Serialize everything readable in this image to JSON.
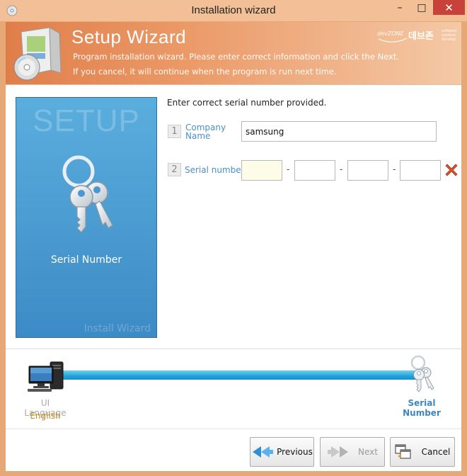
{
  "window": {
    "title": "Installation wizard",
    "min_glyph": "–",
    "max_glyph": "□",
    "close_glyph": "✕"
  },
  "header": {
    "title": "Setup Wizard",
    "line1": "Program installation wizard. Please enter correct information and click the Next.",
    "line2": "If you cancel, it will continue when the program is run next time.",
    "brand_small": "devZONE",
    "brand_big": "데브존",
    "brand_tag": "software solution develop"
  },
  "left_panel": {
    "heading": "SETUP",
    "label": "Serial Number",
    "watermark": "Install Wizard"
  },
  "form": {
    "instruction": "Enter correct serial number provided.",
    "company": {
      "number": "1",
      "label_line1": "Company",
      "label_line2": "Name",
      "value": "samsung"
    },
    "serial": {
      "number": "2",
      "label": "Serial number",
      "separator": "-",
      "parts": [
        "",
        "",
        "",
        ""
      ]
    }
  },
  "progress": {
    "step1_label": "UI Language",
    "step1_value": "English",
    "step2_label": "Serial Number",
    "fraction": 1.0
  },
  "buttons": {
    "previous": "Previous",
    "next": "Next",
    "cancel": "Cancel"
  },
  "colors": {
    "accent_blue": "#22a2db",
    "header_orange": "#e07e4a",
    "close_red": "#c7423a",
    "clear_x": "#d9532c",
    "label_blue": "#4a8fc8",
    "value_gold": "#c28a1e"
  },
  "icons": {
    "app": "disc-icon",
    "header": "software-box-icon",
    "panel": "keys-icon",
    "step1": "computer-icon",
    "step2": "keys-icon",
    "clear": "red-x-icon",
    "prev": "double-arrow-left-icon",
    "next": "double-arrow-right-icon",
    "cancel": "cancel-window-icon"
  }
}
